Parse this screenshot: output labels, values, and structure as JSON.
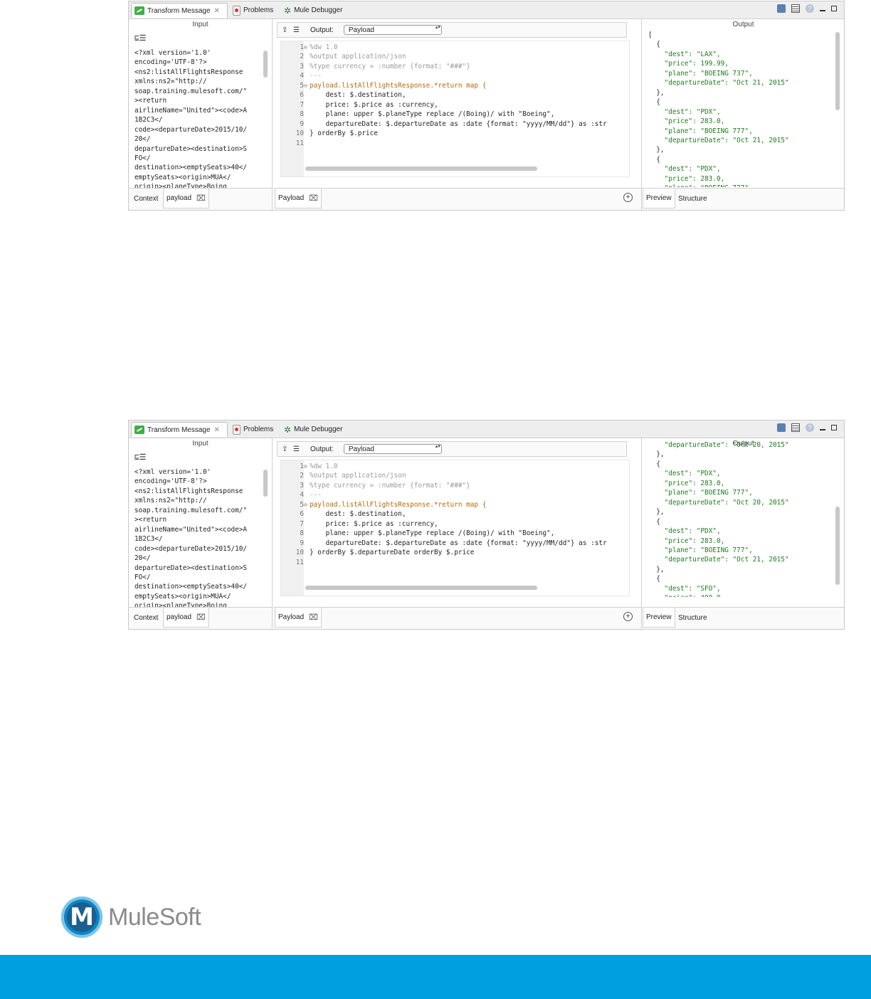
{
  "tabs": {
    "transform": "Transform Message",
    "problems": "Problems",
    "debugger": "Mule Debugger",
    "close_glyph": "✕"
  },
  "input": {
    "title": "Input",
    "tree_glyph": "⊑☰",
    "xml_lines": [
      "<?xml version='1.0'",
      "encoding='UTF-8'?>",
      "<ns2:listAllFlightsResponse",
      "xmlns:ns2=\"http://",
      "soap.training.mulesoft.com/\"",
      "><return",
      "airlineName=\"United\"><code>A",
      "1B2C3</",
      "code><departureDate>2015/10/",
      "20</",
      "departureDate><destination>S",
      "FO</",
      "destination><emptySeats>40</",
      "emptySeats><origin>MUA</",
      "origin><planeType>Boing"
    ],
    "bottom_tabs": {
      "context": "Context",
      "payload": "payload"
    }
  },
  "code_panel": {
    "output_label": "Output:",
    "output_select": "Payload",
    "bottom_tab": "Payload",
    "plus_glyph": "+"
  },
  "output": {
    "title": "Output",
    "bottom_tabs": {
      "preview": "Preview",
      "structure": "Structure"
    }
  },
  "screens": [
    {
      "code": [
        {
          "n": "1",
          "fold": "⊖",
          "t": "%dw 1.0"
        },
        {
          "n": "2",
          "fold": "",
          "t": "%output application/json"
        },
        {
          "n": "3",
          "fold": "",
          "t": "%type currency = :number {format: \"###\"}"
        },
        {
          "n": "4",
          "fold": "",
          "t": "---"
        },
        {
          "n": "5",
          "fold": "⊖",
          "t": "payload.listAllFlightsResponse.*return map {"
        },
        {
          "n": "6",
          "fold": "",
          "t": "    dest: $.destination,"
        },
        {
          "n": "7",
          "fold": "",
          "t": "    price: $.price as :currency,"
        },
        {
          "n": "8",
          "fold": "",
          "t": "    plane: upper $.planeType replace /(Boing)/ with \"Boeing\","
        },
        {
          "n": "9",
          "fold": "",
          "t": "    departureDate: $.departureDate as :date {format: \"yyyy/MM/dd\"} as :str"
        },
        {
          "n": "10",
          "fold": "",
          "t": "} orderBy $.price"
        },
        {
          "n": "11",
          "fold": "",
          "t": ""
        }
      ],
      "json": [
        "[",
        "  {",
        "    \"dest\": \"LAX\",",
        "    \"price\": 199.99,",
        "    \"plane\": \"BOEING 737\",",
        "    \"departureDate\": \"Oct 21, 2015\"",
        "  },",
        "  {",
        "    \"dest\": \"PDX\",",
        "    \"price\": 283.0,",
        "    \"plane\": \"BOEING 777\",",
        "    \"departureDate\": \"Oct 21, 2015\"",
        "  },",
        "  {",
        "    \"dest\": \"PDX\",",
        "    \"price\": 283.0,",
        "    \"plane\": \"BOEING 777\","
      ]
    },
    {
      "code": [
        {
          "n": "1",
          "fold": "⊖",
          "t": "%dw 1.0"
        },
        {
          "n": "2",
          "fold": "",
          "t": "%output application/json"
        },
        {
          "n": "3",
          "fold": "",
          "t": "%type currency = :number {format: \"###\"}"
        },
        {
          "n": "4",
          "fold": "",
          "t": "---"
        },
        {
          "n": "5",
          "fold": "⊖",
          "t": "payload.listAllFlightsResponse.*return map {"
        },
        {
          "n": "6",
          "fold": "",
          "t": "    dest: $.destination,"
        },
        {
          "n": "7",
          "fold": "",
          "t": "    price: $.price as :currency,"
        },
        {
          "n": "8",
          "fold": "",
          "t": "    plane: upper $.planeType replace /(Boing)/ with \"Boeing\","
        },
        {
          "n": "9",
          "fold": "",
          "t": "    departureDate: $.departureDate as :date {format: \"yyyy/MM/dd\"} as :str"
        },
        {
          "n": "10",
          "fold": "",
          "t": "} orderBy $.departureDate orderBy $.price"
        },
        {
          "n": "11",
          "fold": "",
          "t": ""
        }
      ],
      "json": [
        "    \"departureDate\": \"Oct 20, 2015\"",
        "  },",
        "  {",
        "    \"dest\": \"PDX\",",
        "    \"price\": 283.0,",
        "    \"plane\": \"BOEING 777\",",
        "    \"departureDate\": \"Oct 20, 2015\"",
        "  },",
        "  {",
        "    \"dest\": \"PDX\",",
        "    \"price\": 283.0,",
        "    \"plane\": \"BOEING 777\",",
        "    \"departureDate\": \"Oct 21, 2015\"",
        "  },",
        "  {",
        "    \"dest\": \"SFO\",",
        "    \"price\": 400.0,"
      ]
    }
  ],
  "brand": {
    "name": "MuleSoft",
    "logo_letter": "M",
    "footer_color": "#00a0df"
  }
}
